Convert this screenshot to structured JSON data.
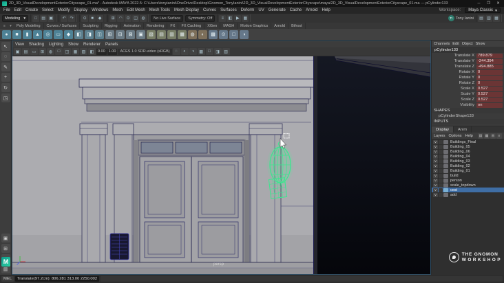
{
  "window": {
    "title": "2D_3D_VisualDevelopmentExteriorCityscape_01.ma* - Autodesk MAYA 2022.5: C:\\Users\\tonyianini\\OneDrive\\Desktop\\Gnomon_TonyIanini\\2D_3D_VisualDevelopmentExteriorCityscape\\maya\\2D_3D_VisualDevelopmentExteriorCityscape_01.ma --- pCylinder133",
    "minimize": "─",
    "maximize": "❐",
    "close": "✕"
  },
  "menu_bar": {
    "items": [
      "File",
      "Edit",
      "Create",
      "Select",
      "Modify",
      "Display",
      "Windows",
      "Mesh",
      "Edit Mesh",
      "Mesh Tools",
      "Mesh Display",
      "Curves",
      "Surfaces",
      "Deform",
      "UV",
      "Generate",
      "Cache",
      "Arnold",
      "Help"
    ],
    "workspace_label": "Workspace:",
    "workspace_value": "Maya Classic",
    "workspace_caret": "▾"
  },
  "status_line": {
    "menuset": "Modeling",
    "menuset_caret": "▾",
    "file_icons": [
      {
        "name": "new-scene-icon",
        "glyph": "□"
      },
      {
        "name": "open-scene-icon",
        "glyph": "▤"
      },
      {
        "name": "save-scene-icon",
        "glyph": "▣"
      }
    ],
    "undo_icons": [
      {
        "name": "undo-icon",
        "glyph": "↶"
      },
      {
        "name": "redo-icon",
        "glyph": "↷"
      }
    ],
    "mask_icons": [
      {
        "name": "select-by-hierarchy-icon",
        "glyph": "⊙"
      },
      {
        "name": "select-by-object-icon",
        "glyph": "■"
      },
      {
        "name": "select-by-component-icon",
        "glyph": "◆"
      }
    ],
    "snap_icons": [
      {
        "name": "snap-to-grid-icon",
        "glyph": "⊞"
      },
      {
        "name": "snap-to-curve-icon",
        "glyph": "◠"
      },
      {
        "name": "snap-to-point-icon",
        "glyph": "⊙"
      },
      {
        "name": "snap-to-plane-icon",
        "glyph": "◫"
      },
      {
        "name": "make-live-icon",
        "glyph": "◍"
      }
    ],
    "no_live_surface": "No Live Surface",
    "symmetry": "Symmetry: Off",
    "history_icons": [
      {
        "name": "construction-history-icon",
        "glyph": "≡"
      },
      {
        "name": "render-icon",
        "glyph": "◧"
      },
      {
        "name": "ipr-render-icon",
        "glyph": "▶"
      },
      {
        "name": "render-settings-icon",
        "glyph": "▦"
      }
    ],
    "account": "Tony Ianini",
    "account_initials": "TI",
    "sidebar_icons": [
      {
        "name": "attribute-editor-toggle-icon",
        "glyph": "▤"
      },
      {
        "name": "tool-settings-toggle-icon",
        "glyph": "▥"
      },
      {
        "name": "channel-box-toggle-icon",
        "glyph": "▦"
      }
    ]
  },
  "shelf": {
    "menu_glyph": "≡",
    "tab_caret": "▾",
    "tabs": [
      "Poly Modeling",
      "Curves / Surfaces",
      "Sculpting",
      "Rigging",
      "Animation",
      "Rendering",
      "FX",
      "FX Caching",
      "XGen",
      "MASH",
      "Motion Graphics",
      "Arnold",
      "Bifrost"
    ],
    "icons": [
      {
        "name": "shelf-sphere-icon",
        "glyph": "●",
        "color": "#4e8296"
      },
      {
        "name": "shelf-cube-icon",
        "glyph": "■",
        "color": "#4e8296"
      },
      {
        "name": "shelf-cylinder-icon",
        "glyph": "▮",
        "color": "#4e8296"
      },
      {
        "name": "shelf-cone-icon",
        "glyph": "▲",
        "color": "#4e8296"
      },
      {
        "name": "shelf-torus-icon",
        "glyph": "◎",
        "color": "#4e8296"
      },
      {
        "name": "shelf-plane-icon",
        "glyph": "▭",
        "color": "#4e8296"
      },
      {
        "name": "shelf-platonic-icon",
        "glyph": "◆",
        "color": "#4e8296"
      },
      {
        "name": "shelf-boolean-union-icon",
        "glyph": "◧",
        "color": "#5b7f8e"
      },
      {
        "name": "shelf-boolean-difference-icon",
        "glyph": "◨",
        "color": "#5b7f8e"
      },
      {
        "name": "shelf-boolean-intersect-icon",
        "glyph": "◫",
        "color": "#5b7f8e"
      },
      {
        "name": "shelf-combine-icon",
        "glyph": "⊞",
        "color": "#6a7a84"
      },
      {
        "name": "shelf-separate-icon",
        "glyph": "⊟",
        "color": "#6a7a84"
      },
      {
        "name": "shelf-extract-icon",
        "glyph": "⊠",
        "color": "#6a7a84"
      },
      {
        "name": "shelf-fill-hole-icon",
        "glyph": "▣",
        "color": "#6a7a84"
      },
      {
        "name": "shelf-multi-cut-icon",
        "glyph": "▧",
        "color": "#777d66"
      },
      {
        "name": "shelf-extrude-icon",
        "glyph": "▤",
        "color": "#777d66"
      },
      {
        "name": "shelf-bevel-icon",
        "glyph": "▥",
        "color": "#777d66"
      },
      {
        "name": "shelf-bridge-icon",
        "glyph": "▦",
        "color": "#777d66"
      },
      {
        "name": "shelf-smooth-icon",
        "glyph": "◍",
        "color": "#7d6f5a"
      },
      {
        "name": "shelf-mirror-icon",
        "glyph": "◐",
        "color": "#7d6f5a"
      },
      {
        "name": "shelf-quad-draw-icon",
        "glyph": "▩",
        "color": "#66788a"
      },
      {
        "name": "shelf-target-weld-icon",
        "glyph": "⊙",
        "color": "#66788a"
      },
      {
        "name": "shelf-crease-icon",
        "glyph": "□",
        "color": "#66788a"
      },
      {
        "name": "shelf-sculpt-icon",
        "glyph": "◑",
        "color": "#66788a"
      }
    ]
  },
  "toolbox": {
    "tools": [
      {
        "name": "select-tool-icon",
        "glyph": "↖"
      },
      {
        "name": "lasso-tool-icon",
        "glyph": "◌"
      },
      {
        "name": "paint-select-tool-icon",
        "glyph": "✎"
      },
      {
        "name": "move-tool-icon",
        "glyph": "+"
      },
      {
        "name": "rotate-tool-icon",
        "glyph": "↻"
      },
      {
        "name": "scale-tool-icon",
        "glyph": "◳"
      }
    ],
    "layouts": [
      {
        "name": "single-pane-layout-icon",
        "glyph": "▣"
      },
      {
        "name": "four-pane-layout-icon",
        "glyph": "⊞"
      },
      {
        "name": "two-pane-layout-icon",
        "glyph": "◫"
      },
      {
        "name": "outliner-layout-icon",
        "glyph": "▥"
      }
    ]
  },
  "viewport": {
    "menus": [
      "View",
      "Shading",
      "Lighting",
      "Show",
      "Renderer",
      "Panels"
    ],
    "bar_left_icons": [
      {
        "name": "camera-attributes-icon",
        "glyph": "▣"
      },
      {
        "name": "bookmarks-icon",
        "glyph": "▤"
      },
      {
        "name": "image-plane-icon",
        "glyph": "▭"
      },
      {
        "name": "2d-pan-zoom-icon",
        "glyph": "⊞"
      },
      {
        "name": "oversampling-icon",
        "glyph": "◍"
      },
      {
        "name": "film-gate-icon",
        "glyph": "□"
      },
      {
        "name": "resolution-gate-icon",
        "glyph": "◫"
      },
      {
        "name": "gate-mask-icon",
        "glyph": "▦"
      },
      {
        "name": "field-chart-icon",
        "glyph": "▧"
      },
      {
        "name": "safe-action-icon",
        "glyph": "◧"
      }
    ],
    "exposure": "0.00",
    "gamma": "1.00",
    "aces": "ACES 1.0 SDR-video (sRGB)",
    "bar_right_icons": [
      {
        "name": "lighting-icon",
        "glyph": "◌"
      },
      {
        "name": "shadows-icon",
        "glyph": "◐"
      },
      {
        "name": "ambient-occlusion-icon",
        "glyph": "◑"
      },
      {
        "name": "anti-alias-icon",
        "glyph": "▩"
      },
      {
        "name": "isolate-select-icon",
        "glyph": "□"
      },
      {
        "name": "xray-icon",
        "glyph": "◨"
      },
      {
        "name": "wireframe-on-shaded-icon",
        "glyph": "▥"
      }
    ],
    "camera_label": "persp"
  },
  "channel_box": {
    "menus": [
      "Channels",
      "Edit",
      "Object",
      "Show"
    ],
    "object_name": "pCylinder133",
    "rows": [
      {
        "label": "Translate X",
        "value": "789.879"
      },
      {
        "label": "Translate Y",
        "value": "-244.394"
      },
      {
        "label": "Translate Z",
        "value": "-494.885"
      },
      {
        "label": "Rotate X",
        "value": "0"
      },
      {
        "label": "Rotate Y",
        "value": "0"
      },
      {
        "label": "Rotate Z",
        "value": "0"
      },
      {
        "label": "Scale X",
        "value": "0.527"
      },
      {
        "label": "Scale Y",
        "value": "0.527"
      },
      {
        "label": "Scale Z",
        "value": "0.527"
      },
      {
        "label": "Visibility",
        "value": "on"
      }
    ],
    "shapes_header": "SHAPES",
    "shape_name": "pCylinderShape133",
    "inputs_header": "INPUTS"
  },
  "layer_editor": {
    "tabs": [
      "Display",
      "Anim"
    ],
    "menus": [
      "Layers",
      "Options",
      "Help"
    ],
    "toolbar_icons": [
      {
        "name": "move-layer-up-icon",
        "glyph": "▤"
      },
      {
        "name": "empty-layer-icon",
        "glyph": "▦"
      },
      {
        "name": "new-layer-icon",
        "glyph": "⊞"
      },
      {
        "name": "layer-options-icon",
        "glyph": "≡"
      }
    ],
    "layers": [
      {
        "name": "Buildings_Final",
        "v": "V"
      },
      {
        "name": "Building_05",
        "v": "V"
      },
      {
        "name": "Building_06",
        "v": "V"
      },
      {
        "name": "Building_04",
        "v": "V"
      },
      {
        "name": "Building_03",
        "v": "V"
      },
      {
        "name": "Building_02",
        "v": "V"
      },
      {
        "name": "Building_01",
        "v": "V"
      },
      {
        "name": "build",
        "v": "V"
      },
      {
        "name": "person",
        "v": "V"
      },
      {
        "name": "scale_topdown",
        "v": "V"
      },
      {
        "name": "cest",
        "v": "V",
        "selected": true,
        "color": "#7ab0d4"
      },
      {
        "name": "add",
        "v": "V"
      }
    ]
  },
  "command_line": {
    "language": "MEL",
    "result_text": "Translate(97.2cm): 806.281 313.00 2250.002"
  },
  "watermarks": {
    "maya_logo": "M",
    "gnomon_line1": "THE GNOMON",
    "gnomon_line2": "WORKSHOP"
  },
  "colors": {
    "accent": "#3f6ea5",
    "selected_green": "#39e88e",
    "keyed_bg": "#6b3535"
  }
}
